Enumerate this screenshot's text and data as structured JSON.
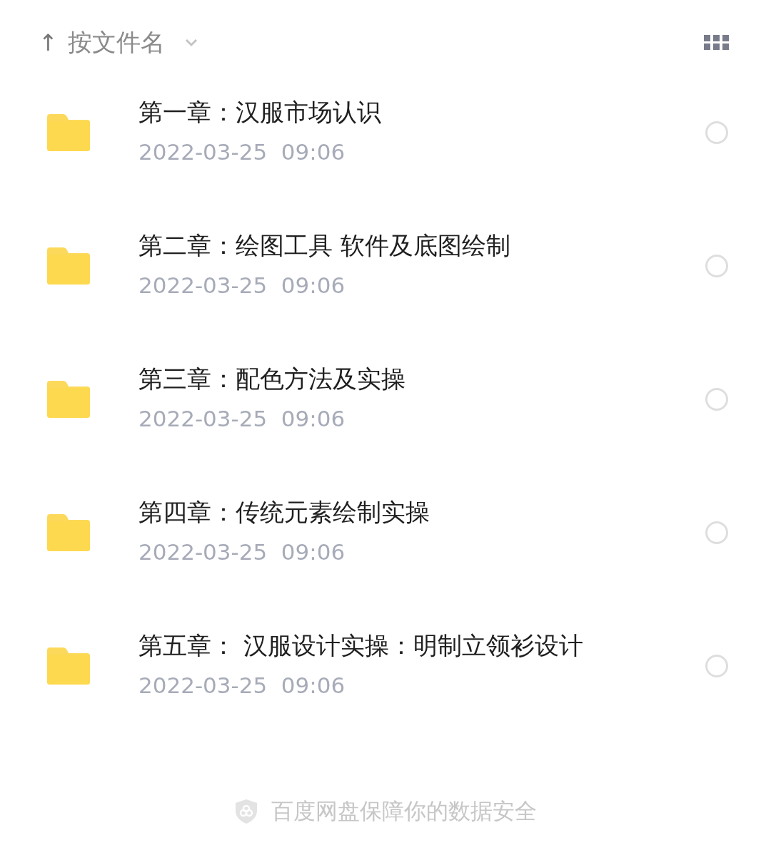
{
  "sort_bar": {
    "arrow": "↑",
    "label": "按文件名"
  },
  "files": [
    {
      "name": "第一章：汉服市场认识",
      "date": "2022-03-25  09:06",
      "selected": false
    },
    {
      "name": "第二章：绘图工具 软件及底图绘制",
      "date": "2022-03-25  09:06",
      "selected": false
    },
    {
      "name": "第三章：配色方法及实操",
      "date": "2022-03-25  09:06",
      "selected": false
    },
    {
      "name": "第四章：传统元素绘制实操",
      "date": "2022-03-25  09:06",
      "selected": false
    },
    {
      "name": "第五章： 汉服设计实操：明制立领衫设计",
      "date": "2022-03-25  09:06",
      "selected": false
    }
  ],
  "footer": "百度网盘保障你的数据安全"
}
